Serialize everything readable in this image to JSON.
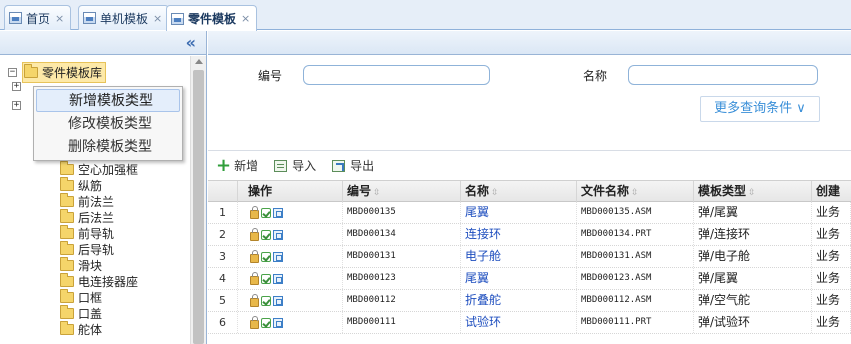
{
  "tabs": [
    {
      "label": "首页",
      "active": false
    },
    {
      "label": "单机模板",
      "active": false
    },
    {
      "label": "零件模板",
      "active": true
    }
  ],
  "left_panel": {
    "collapse_icon": "double-chevron-left-icon",
    "tree_root": {
      "label": "零件模板库",
      "expanded": true
    },
    "tree_items": [
      "空心加强框",
      "纵筋",
      "前法兰",
      "后法兰",
      "前导轨",
      "后导轨",
      "滑块",
      "电连接器座",
      "口框",
      "口盖",
      "舵体"
    ]
  },
  "context_menu": {
    "items": [
      "新增模板类型",
      "修改模板类型",
      "删除模板类型"
    ],
    "highlighted_index": 0
  },
  "search": {
    "code_label": "编号",
    "code_value": "",
    "name_label": "名称",
    "name_value": "",
    "more_button": "更多查询条件 ∨"
  },
  "toolbar": {
    "add_label": "新增",
    "import_label": "导入",
    "export_label": "导出"
  },
  "grid": {
    "columns": [
      "操作",
      "编号",
      "名称",
      "文件名称",
      "模板类型",
      "创建"
    ],
    "rows": [
      {
        "num": "1",
        "code": "MBD000135",
        "name": "尾翼",
        "file": "MBD000135.ASM",
        "type": "弹/尾翼",
        "creator": "业务"
      },
      {
        "num": "2",
        "code": "MBD000134",
        "name": "连接环",
        "file": "MBD000134.PRT",
        "type": "弹/连接环",
        "creator": "业务"
      },
      {
        "num": "3",
        "code": "MBD000131",
        "name": "电子舱",
        "file": "MBD000131.ASM",
        "type": "弹/电子舱",
        "creator": "业务"
      },
      {
        "num": "4",
        "code": "MBD000123",
        "name": "尾翼",
        "file": "MBD000123.ASM",
        "type": "弹/尾翼",
        "creator": "业务"
      },
      {
        "num": "5",
        "code": "MBD000112",
        "name": "折叠舵",
        "file": "MBD000112.ASM",
        "type": "弹/空气舵",
        "creator": "业务"
      },
      {
        "num": "6",
        "code": "MBD000111",
        "name": "试验环",
        "file": "MBD000111.PRT",
        "type": "弹/试验环",
        "creator": "业务"
      }
    ]
  },
  "colors": {
    "tab_bar_bg": "#e6eef8",
    "link_blue": "#1f4fbf",
    "more_button_text": "#3a8fd8",
    "add_green": "#2f9e3a",
    "selected_node_bg": "#fde9a8"
  }
}
